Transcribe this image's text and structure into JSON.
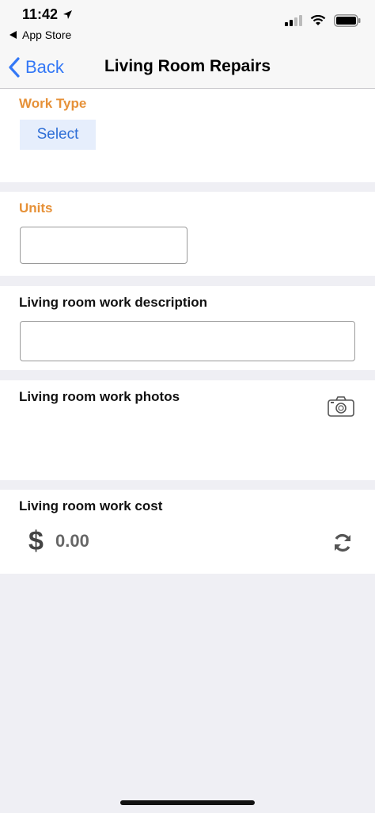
{
  "status_bar": {
    "time": "11:42",
    "back_to_app": "App Store"
  },
  "nav": {
    "back_label": "Back",
    "title": "Living Room Repairs"
  },
  "work_type": {
    "label": "Work Type",
    "button_label": "Select"
  },
  "units": {
    "label": "Units",
    "value": ""
  },
  "description": {
    "label": "Living room work description",
    "value": ""
  },
  "photos": {
    "label": "Living room work photos",
    "icon": "camera-icon"
  },
  "cost": {
    "label": "Living room work cost",
    "currency_symbol": "$",
    "amount": "0.00",
    "icon": "refresh-icon"
  },
  "colors": {
    "accent": "#3478f6",
    "label_orange": "#e69138",
    "background": "#efeff4"
  }
}
